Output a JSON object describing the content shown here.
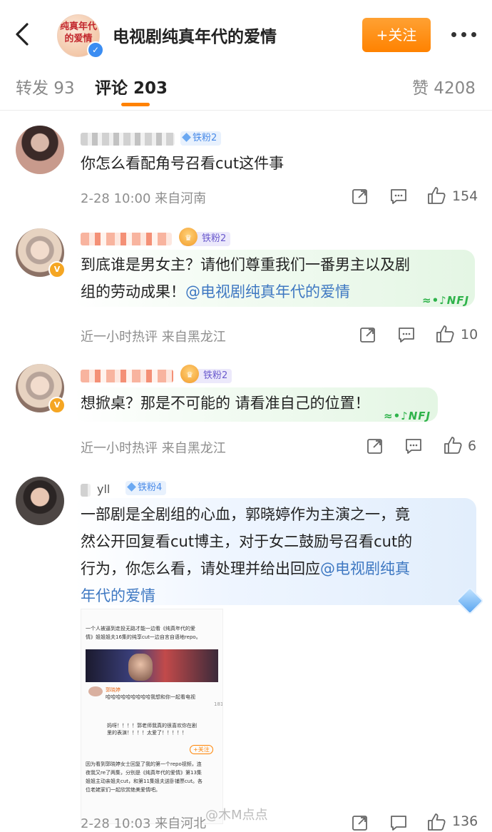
{
  "header": {
    "account_name": "电视剧纯真年代的爱情",
    "avatar_logo_text": "纯真年代的爱情",
    "follow_label": "+关注"
  },
  "tabs": [
    {
      "label": "转发 93"
    },
    {
      "label": "评论 203"
    },
    {
      "label": "赞 4208"
    }
  ],
  "comments": [
    {
      "fan_badge": "铁粉2",
      "text": "你怎么看配角号召看cut这件事",
      "meta": "2-28 10:00  来自河南",
      "likes": "154"
    },
    {
      "fan_badge": "铁粉2",
      "text_line1": "到底谁是男女主？请他们尊重我们一番男主以及剧",
      "text_line2_plain": "组的劳动成果！",
      "mention": "@电视剧纯真年代的爱情",
      "meta": "近一小时热评  来自黑龙江",
      "likes": "10"
    },
    {
      "fan_badge": "铁粉2",
      "text": "想掀桌？那是不可能的 请看准自己的位置！",
      "meta": "近一小时热评  来自黑龙江",
      "likes": "6"
    },
    {
      "name_partial": "yll",
      "fan_badge": "铁粉4",
      "text_line1": "一部剧是全剧组的心血，郭晓婷作为主演之一，竟",
      "text_line2": "然公开回复看cut博主，对于女二鼓励号召看cut的",
      "text_line3_plain": "行为，你怎么看，请处理并给出回应",
      "mention_part1": "@电视剧纯真",
      "mention_part2": "年代的爱情",
      "embed": {
        "line1": "一个人被逼到走投无路才能一边看《纯真年代的爱",
        "line2": "情》姐姐姐夫16集的纯享cut一边自言自语地repo。",
        "poster": "郭晓婷",
        "reply1": "哈哈哈哈哈哈哈哈哈我想和你一起看电视",
        "count": "181",
        "reply2a": "妈呀！！！！郭老师我真的很喜欢你在剧",
        "reply2b": "里的表演！！！！太爱了！！！！！",
        "follow": "+关注",
        "para1": "因为看到郭晓婷女士回复了我的第一个repo视频，连",
        "para2": "夜我又re了两集，分别是《纯真年代的爱情》第13集",
        "para3": "姐姐主动亲姐夫cut，和第11集姐夫送卧铺票cut。各",
        "para4": "位老姥家们一起欣赏绝美爱情吧。"
      },
      "meta_partial": "2-28 10:03  来自河北",
      "likes": "136"
    }
  ],
  "watermark": "@木M点点"
}
